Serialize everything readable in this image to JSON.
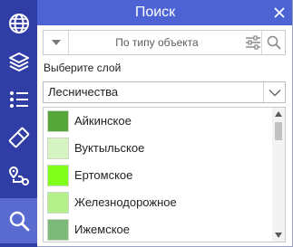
{
  "rail": {
    "items": [
      {
        "icon": "globe-icon"
      },
      {
        "icon": "layers-icon"
      },
      {
        "icon": "list-icon"
      },
      {
        "icon": "eraser-icon"
      },
      {
        "icon": "route-icon"
      },
      {
        "icon": "search-icon",
        "active": true
      }
    ]
  },
  "panel": {
    "title": "Поиск",
    "search": {
      "placeholder": "По типу объекта",
      "value": ""
    },
    "layer_label": "Выберите слой",
    "layer_value": "Лесничества",
    "items": [
      {
        "label": "Айкинское",
        "color": "#55a638"
      },
      {
        "label": "Вуктыльское",
        "color": "#d6f5c2"
      },
      {
        "label": "Ертомское",
        "color": "#80ff1a"
      },
      {
        "label": "Железнодорожное",
        "color": "#b4f088"
      },
      {
        "label": "Ижемское",
        "color": "#7cb878"
      }
    ]
  },
  "colors": {
    "rail": "#2f3da4",
    "rail_active": "#5a6bd0",
    "titlebar": "#4d63d4"
  }
}
